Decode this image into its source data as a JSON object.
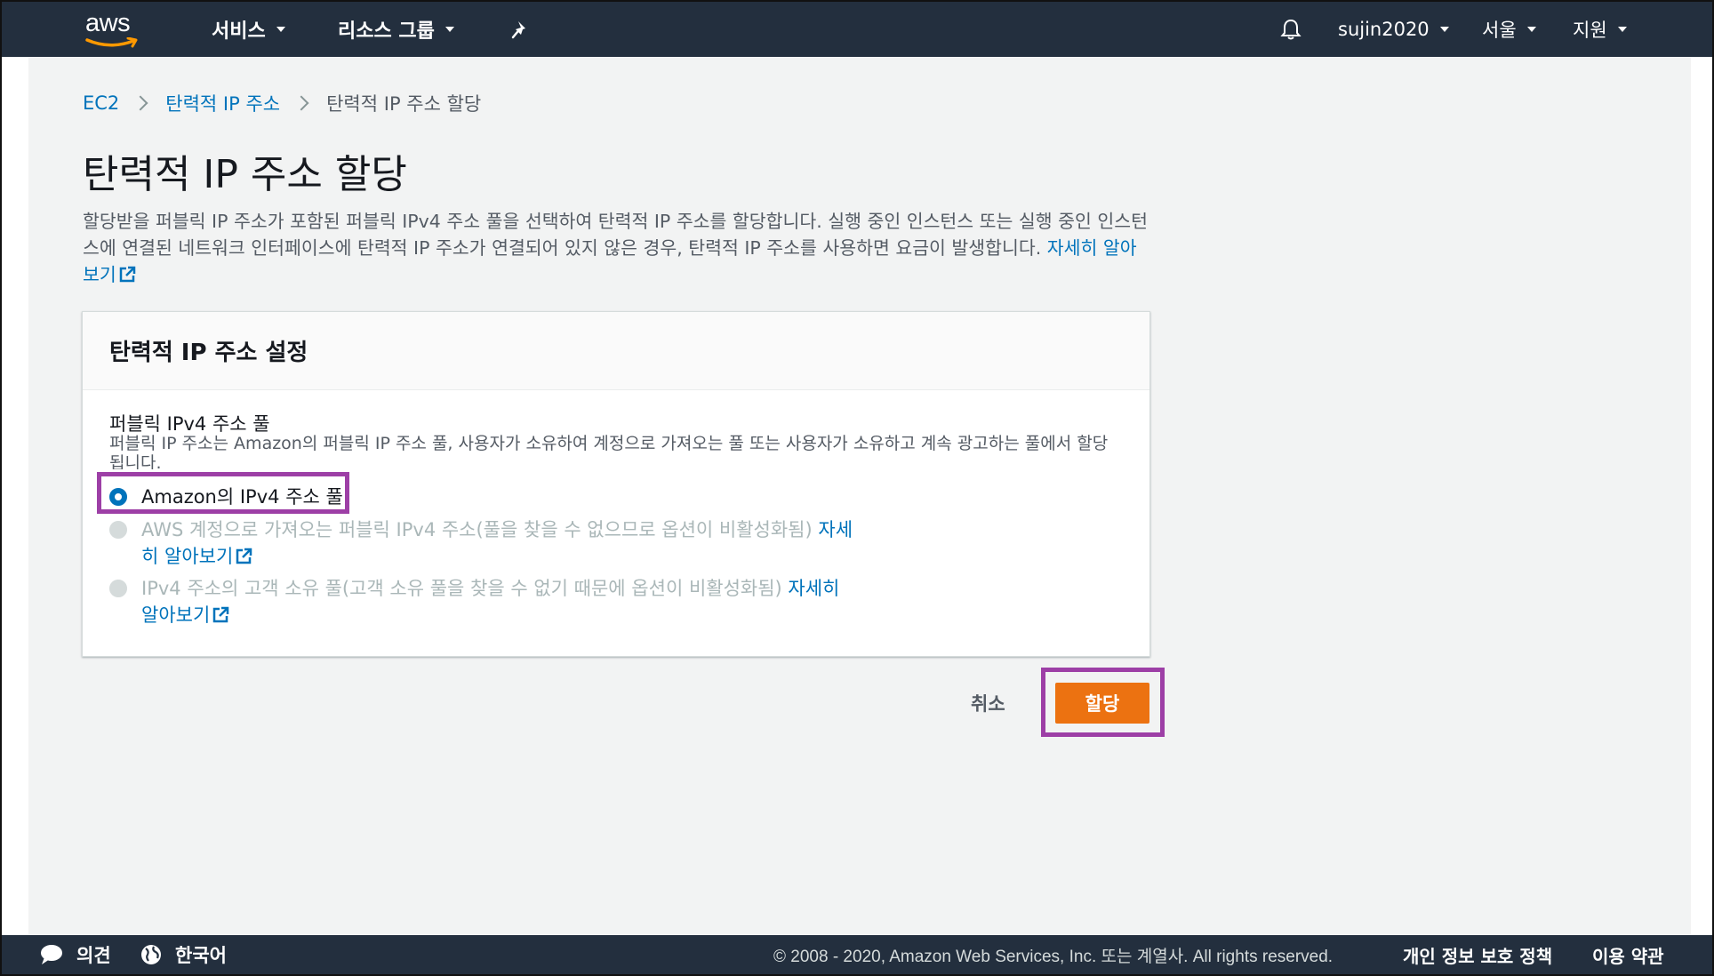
{
  "topnav": {
    "logo_text": "aws",
    "services_label": "서비스",
    "resource_groups_label": "리소스 그룹",
    "pin_icon": "pin-icon",
    "bell_icon": "bell-icon",
    "account_label": "sujin2020",
    "region_label": "서울",
    "support_label": "지원"
  },
  "breadcrumb": {
    "items": [
      "EC2",
      "탄력적 IP 주소"
    ],
    "current": "탄력적 IP 주소 할당"
  },
  "page": {
    "title": "탄력적 IP 주소 할당",
    "description": "할당받을 퍼블릭 IP 주소가 포함된 퍼블릭 IPv4 주소 풀을 선택하여 탄력적 IP 주소를 할당합니다. 실행 중인 인스턴스 또는 실행 중인 인스턴스에 연결된 네트워크 인터페이스에 탄력적 IP 주소가 연결되어 있지 않은 경우, 탄력적 IP 주소를 사용하면 요금이 발생합니다.",
    "learn_more": "자세히 알아보기"
  },
  "panel": {
    "title": "탄력적 IP 주소 설정",
    "field_label": "퍼블릭 IPv4 주소 풀",
    "field_description": "퍼블릭 IP 주소는 Amazon의 퍼블릭 IP 주소 풀, 사용자가 소유하여 계정으로 가져오는 풀 또는 사용자가 소유하고 계속 광고하는 풀에서 할당됩니다.",
    "options": [
      {
        "label": "Amazon의 IPv4 주소 풀",
        "checked": true,
        "disabled": false
      },
      {
        "label": "AWS 계정으로 가져오는 퍼블릭 IPv4 주소(풀을 찾을 수 없으므로 옵션이 비활성화됨)",
        "link": "자세히 알아보기",
        "checked": false,
        "disabled": true
      },
      {
        "label": "IPv4 주소의 고객 소유 풀(고객 소유 풀을 찾을 수 없기 때문에 옵션이 비활성화됨)",
        "link": "자세히 알아보기",
        "checked": false,
        "disabled": true
      }
    ]
  },
  "actions": {
    "cancel_label": "취소",
    "allocate_label": "할당"
  },
  "footer": {
    "feedback_label": "의견",
    "language_label": "한국어",
    "copyright": "© 2008 - 2020, Amazon Web Services, Inc. 또는 계열사. All rights reserved.",
    "privacy_label": "개인 정보 보호 정책",
    "terms_label": "이용 약관"
  },
  "colors": {
    "nav_bg": "#232f3e",
    "link": "#0073bb",
    "primary": "#ec7211",
    "highlight": "#9d3fa6"
  }
}
